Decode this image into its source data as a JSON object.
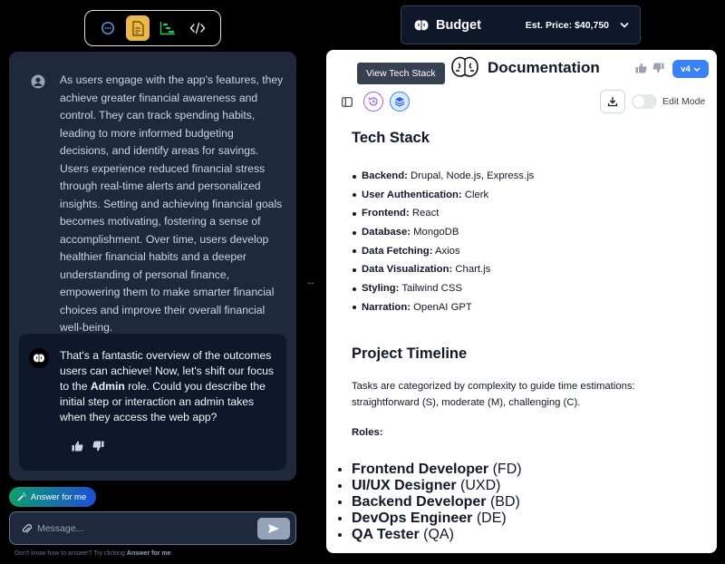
{
  "left": {
    "toolbar": {
      "buttons": [
        {
          "icon": "chat-icon",
          "active": false
        },
        {
          "icon": "document-icon",
          "active": true
        },
        {
          "icon": "gantt-icon",
          "active": false
        },
        {
          "icon": "code-icon",
          "active": false
        }
      ]
    },
    "messages": {
      "user_text": "As users engage with the app's features, they achieve greater financial awareness and control. They can track spending habits, leading to more informed budgeting decisions, and identify areas for savings. Users experience reduced financial stress through real-time alerts and personalized insights. Setting and achieving financial goals becomes motivating, fostering a sense of accomplishment. Over time, users develop healthier financial habits and a deeper understanding of personal finance, empowering them to make smarter financial choices and improve their overall financial well-being.",
      "bot_text_before": "That's a fantastic overview of the outcomes users can achieve! Now, let's shift our focus to the ",
      "bot_text_bold": "Admin",
      "bot_text_after": " role. Could you describe the initial step or interaction an admin takes when they access the web app?"
    },
    "answer_button": "Answer for me",
    "composer": {
      "placeholder": "Message..."
    },
    "hint": {
      "prefix": "Don't know how to answer? Try clicking ",
      "bold": "Answer for me",
      "suffix": "."
    }
  },
  "budget": {
    "title": "Budget",
    "price": "Est. Price: $40,750"
  },
  "doc": {
    "title": "Documentation",
    "version": "v4",
    "tooltip": "View Tech Stack",
    "edit_mode_label": "Edit Mode",
    "edit_mode_on": false,
    "tech_stack": {
      "heading": "Tech Stack",
      "items": [
        {
          "label": "Backend:",
          "value": " Drupal, Node.js, Express.js"
        },
        {
          "label": "User Authentication:",
          "value": " Clerk"
        },
        {
          "label": "Frontend:",
          "value": " React"
        },
        {
          "label": "Database:",
          "value": " MongoDB"
        },
        {
          "label": "Data Fetching:",
          "value": " Axios"
        },
        {
          "label": "Data Visualization:",
          "value": " Chart.js"
        },
        {
          "label": "Styling:",
          "value": " Tailwind CSS"
        },
        {
          "label": "Narration:",
          "value": " OpenAI GPT"
        }
      ]
    },
    "timeline": {
      "heading": "Project Timeline",
      "description": "Tasks are categorized by complexity to guide time estimations: straightforward (S), moderate (M), challenging (C).",
      "roles_label": "Roles:",
      "roles": [
        {
          "label": "Frontend Developer",
          "value": " (FD)"
        },
        {
          "label": "UI/UX Designer",
          "value": " (UXD)"
        },
        {
          "label": "Backend Developer",
          "value": " (BD)"
        },
        {
          "label": "DevOps Engineer",
          "value": " (DE)"
        },
        {
          "label": "QA Tester",
          "value": " (QA)"
        }
      ]
    }
  },
  "colors": {
    "accent_blue": "#3b82f6",
    "active_tab": "#e9b94a",
    "chat_bg": "#1e293b",
    "bot_bubble": "#0f172a"
  }
}
